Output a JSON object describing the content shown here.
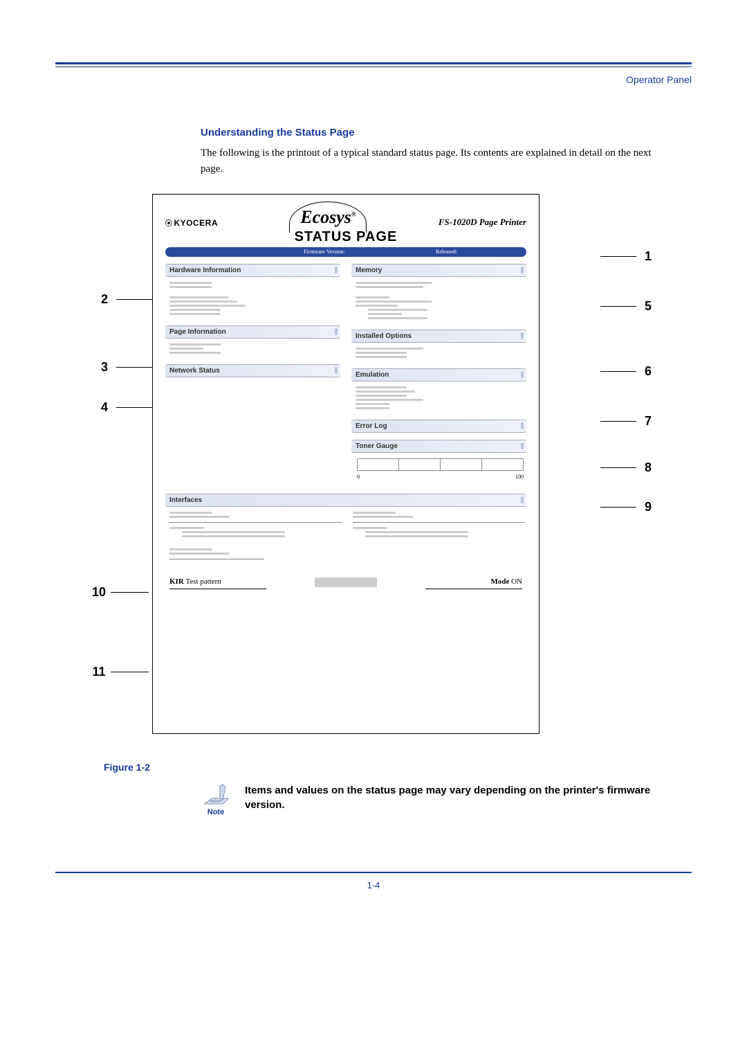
{
  "header": {
    "label": "Operator Panel"
  },
  "section": {
    "title": "Understanding the Status Page",
    "body": "The following is the printout of a typical standard status page. Its contents are explained in detail on the next page."
  },
  "status_page": {
    "brand": "KYOCERA",
    "logo": "Ecosys",
    "reg": "®",
    "printer": "FS-1020D  Page Printer",
    "title": "STATUS PAGE",
    "fw_label": "Firmware Version:",
    "released_label": "Released:",
    "panels_left": [
      "Hardware Information",
      "Page Information",
      "Network Status"
    ],
    "panels_right": [
      "Memory",
      "Installed Options",
      "Emulation",
      "Error Log",
      "Toner Gauge"
    ],
    "gauge_min": "0",
    "gauge_max": "100",
    "interfaces_title": "Interfaces",
    "kir": {
      "bold": "KIR",
      "rest": " Test pattern",
      "mode_label": "Mode",
      "mode_value": "ON"
    }
  },
  "callouts": {
    "left": [
      "2",
      "3",
      "4",
      "10",
      "11"
    ],
    "right": [
      "1",
      "5",
      "6",
      "7",
      "8",
      "9"
    ]
  },
  "figure_caption": "Figure 1-2",
  "note": {
    "label": "Note",
    "text": "Items and values on the status page may vary depending on the printer's firmware version."
  },
  "page_number": "1-4"
}
